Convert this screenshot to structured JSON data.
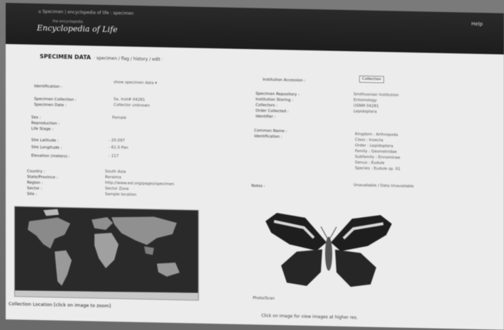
{
  "topbar": {
    "crumbs": "⌂ Specimen   |   encyclopedia of life : specimen",
    "logo_small": "the encyclopedia",
    "logo": "Encyclopedia of Life",
    "help": "Help"
  },
  "header": {
    "title": "SPECIMEN DATA",
    "subtitle": "· specimen / flag / history / edit ·"
  },
  "left_fields": [
    {
      "label": "Identification :",
      "value": "show specimen data ▾"
    },
    {
      "label": "Specimen Collection :",
      "value": "Sa. Inst# 04281"
    },
    {
      "label": "Specimen Date :",
      "value": "Collector unknown"
    },
    {
      "label": "Sex :",
      "value": "Female"
    },
    {
      "label": "Reproduction :",
      "value": ""
    },
    {
      "label": "Life Stage :",
      "value": ""
    },
    {
      "label": "Site Latitude :",
      "value": "- 20.097"
    },
    {
      "label": "Site Longitude :",
      "value": "- 61.0 Pan"
    },
    {
      "label": "Elevation (meters) :",
      "value": "- 117"
    },
    {
      "label": "Country :",
      "value": "South Asia"
    },
    {
      "label": "State/Province :",
      "value": "Roraima"
    },
    {
      "label": "Region :",
      "value": "http://www.eol.org/pages/specimen"
    },
    {
      "label": "Sector :",
      "value": "Sector Zone"
    },
    {
      "label": "Site :",
      "value": "Sample location"
    }
  ],
  "right_fields": [
    {
      "label": "Institution Accession :",
      "value": "Collection"
    },
    {
      "label": "Specimen Repository :",
      "value": "Smithsonian Institution"
    },
    {
      "label": "Institution Storing :",
      "value": "Entomology"
    },
    {
      "label": "Collectors :",
      "value": "USNM 04281"
    },
    {
      "label": "Order Collected :",
      "value": "Lepidoptera"
    },
    {
      "label": "Identifier :",
      "value": ""
    },
    {
      "label": "Common Name :",
      "value": ""
    },
    {
      "label": "Identification :",
      "value": ""
    }
  ],
  "taxonomy": [
    "Kingdom : Arthropoda",
    "Class : Insecta",
    "Order : Lepidoptera",
    "Family : Geometridae",
    "Subfamily : Ennominae",
    "Genus : Eudule",
    "Species : Eudule sp. 01"
  ],
  "notes_label": "Notes :",
  "notes_value": "Unavailable / Data Unavailable",
  "collection_button": "Collection",
  "map_caption": "Collection Location [click on image to zoom]",
  "moth_credit": "Photo/Scan",
  "moth_caption": "Click on image for view images at higher res."
}
